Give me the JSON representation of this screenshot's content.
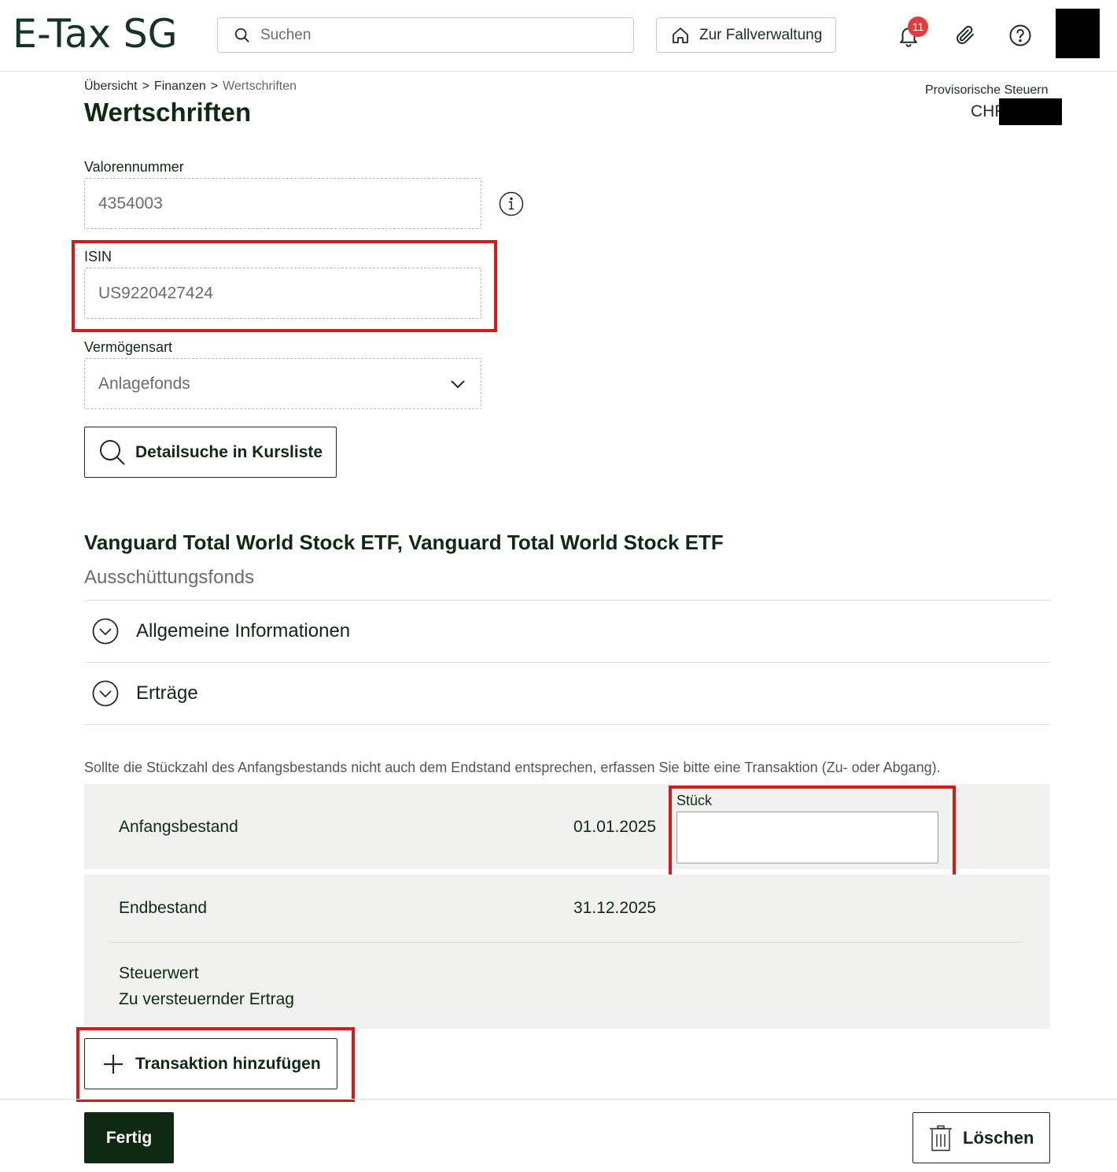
{
  "header": {
    "logo": "E-Tax SG",
    "search_placeholder": "Suchen",
    "home_button_label": "Zur Fallverwaltung",
    "notification_count": "11"
  },
  "breadcrumb": {
    "items": [
      "Übersicht",
      "Finanzen",
      "Wertschriften"
    ],
    "separator": ">"
  },
  "page": {
    "title": "Wertschriften",
    "provisional_tax_label": "Provisorische Steuern",
    "provisional_tax_currency": "CHF"
  },
  "form": {
    "valor_label": "Valorennummer",
    "valor_value": "4354003",
    "isin_label": "ISIN",
    "isin_value": "US9220427424",
    "asset_type_label": "Vermögensart",
    "asset_type_value": "Anlagefonds",
    "detail_search_label": "Detailsuche in Kursliste"
  },
  "fund": {
    "title": "Vanguard Total World Stock ETF, Vanguard Total World Stock ETF",
    "subtitle": "Ausschüttungsfonds",
    "sections": [
      "Allgemeine Informationen",
      "Erträge"
    ]
  },
  "holdings": {
    "hint": "Sollte die Stückzahl des Anfangsbestands nicht auch dem Endstand entsprechen, erfassen Sie bitte eine Transaktion (Zu- oder Abgang).",
    "start_label": "Anfangsbestand",
    "start_date": "01.01.2025",
    "quantity_label": "Stück",
    "quantity_value": "",
    "end_label": "Endbestand",
    "end_date": "31.12.2025",
    "tax_value_label": "Steuerwert",
    "taxable_income_label": "Zu versteuernder Ertrag"
  },
  "actions": {
    "add_transaction": "Transaktion hinzufügen",
    "done": "Fertig",
    "delete": "Löschen"
  },
  "colors": {
    "brand_dark": "#0f2a12",
    "highlight_red": "#d7191c",
    "badge_red": "#e23d3d",
    "panel_bg": "#f1f1ef"
  }
}
